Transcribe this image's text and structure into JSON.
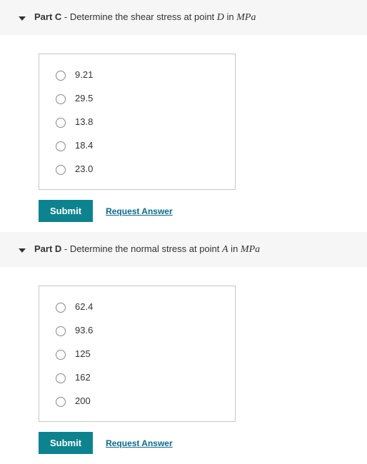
{
  "parts": [
    {
      "label": "Part C",
      "prompt_prefix": " - Determine the shear stress at point ",
      "variable": "D",
      "prompt_suffix": " in ",
      "unit": "MPa",
      "options": [
        "9.21",
        "29.5",
        "13.8",
        "18.4",
        "23.0"
      ],
      "submit_label": "Submit",
      "request_label": "Request Answer"
    },
    {
      "label": "Part D",
      "prompt_prefix": " - Determine the normal stress at point ",
      "variable": "A",
      "prompt_suffix": " in ",
      "unit": "MPa",
      "options": [
        "62.4",
        "93.6",
        "125",
        "162",
        "200"
      ],
      "submit_label": "Submit",
      "request_label": "Request Answer"
    }
  ]
}
